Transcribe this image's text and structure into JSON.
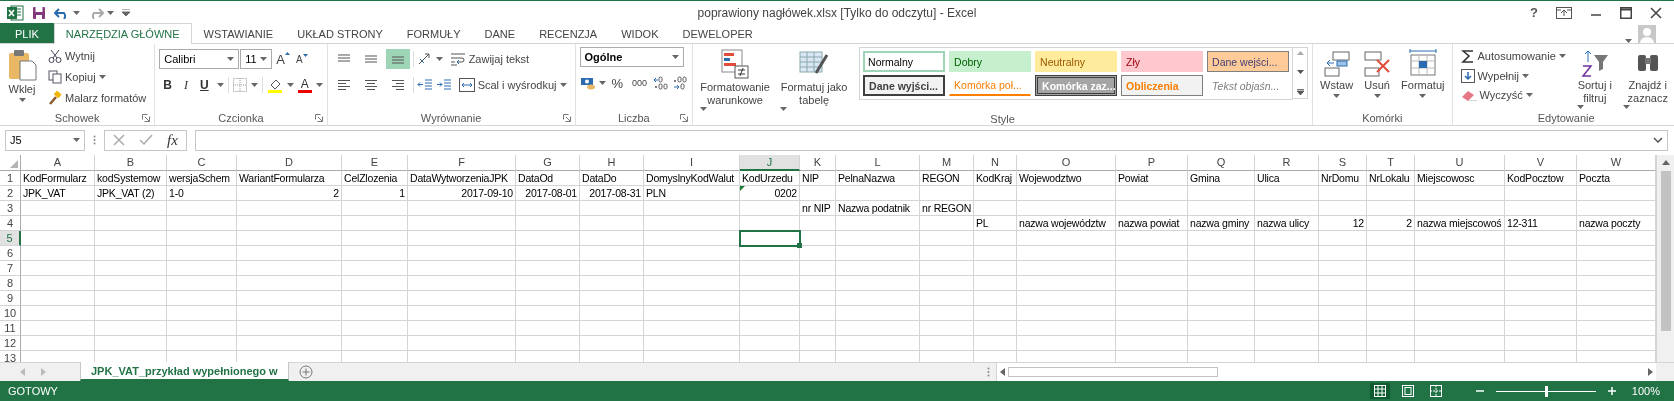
{
  "window": {
    "title": "poprawiony nagłówek.xlsx  [Tylko do odczytu] - Excel",
    "help": "?"
  },
  "tabs": [
    {
      "label": "PLIK",
      "kind": "file",
      "selected": false
    },
    {
      "label": "NARZĘDZIA GŁÓWNE",
      "kind": "tab",
      "selected": true
    },
    {
      "label": "WSTAWIANIE",
      "kind": "tab",
      "selected": false
    },
    {
      "label": "UKŁAD STRONY",
      "kind": "tab",
      "selected": false
    },
    {
      "label": "FORMUŁY",
      "kind": "tab",
      "selected": false
    },
    {
      "label": "DANE",
      "kind": "tab",
      "selected": false
    },
    {
      "label": "RECENZJA",
      "kind": "tab",
      "selected": false
    },
    {
      "label": "WIDOK",
      "kind": "tab",
      "selected": false
    },
    {
      "label": "DEWELOPER",
      "kind": "tab",
      "selected": false
    }
  ],
  "ribbon": {
    "clipboard": {
      "label": "Schowek",
      "paste": "Wklej",
      "cut": "Wytnij",
      "copy": "Kopiuj",
      "format_painter": "Malarz formatów"
    },
    "font": {
      "label": "Czcionka",
      "family": "Calibri",
      "size": "11",
      "grow": "A",
      "shrink": "A",
      "bold": "B",
      "italic": "I",
      "underline": "U",
      "font_color": "A"
    },
    "alignment": {
      "label": "Wyrównanie",
      "wrap": "Zawijaj tekst",
      "merge": "Scal i wyśrodkuj",
      "vertical": [
        {
          "selected": false
        },
        {
          "selected": false
        },
        {
          "selected": true
        }
      ],
      "horizontal": [
        {
          "selected": false
        },
        {
          "selected": false
        },
        {
          "selected": false
        }
      ]
    },
    "number": {
      "label": "Liczba",
      "format": "Ogólne",
      "percent": "%",
      "thousands": "000"
    },
    "styles": {
      "label": "Style",
      "conditional": "Formatowanie warunkowe",
      "as_table": "Formatuj jako tabelę",
      "gallery": [
        {
          "label": "Normalny",
          "kind": "normal",
          "selected": true
        },
        {
          "label": "Dobry",
          "kind": "good",
          "selected": false
        },
        {
          "label": "Neutralny",
          "kind": "neutral",
          "selected": false
        },
        {
          "label": "Zły",
          "kind": "bad",
          "selected": false
        },
        {
          "label": "Dane wejści...",
          "kind": "input",
          "selected": false
        },
        {
          "label": "Dane wyjści...",
          "kind": "output",
          "selected": false
        },
        {
          "label": "Komórka poł...",
          "kind": "linked",
          "selected": false
        },
        {
          "label": "Komórka zaz...",
          "kind": "check",
          "selected": false
        },
        {
          "label": "Obliczenia",
          "kind": "calculation",
          "selected": false
        },
        {
          "label": "Tekst objaśn...",
          "kind": "explanatory",
          "selected": false
        }
      ]
    },
    "cells": {
      "label": "Komórki",
      "insert": "Wstaw",
      "delete": "Usuń",
      "format": "Formatuj"
    },
    "editing": {
      "label": "Edytowanie",
      "autosum": "Autosumowanie",
      "fill": "Wypełnij",
      "clear": "Wyczyść",
      "sort": "Sortuj i filtruj",
      "find": "Znajdź i zaznacz"
    }
  },
  "formula_bar": {
    "name_box": "J5",
    "fx": "fx"
  },
  "sheet": {
    "columns": [
      {
        "label": "A",
        "selected": false
      },
      {
        "label": "B",
        "selected": false
      },
      {
        "label": "C",
        "selected": false
      },
      {
        "label": "D",
        "selected": false
      },
      {
        "label": "E",
        "selected": false
      },
      {
        "label": "F",
        "selected": false
      },
      {
        "label": "G",
        "selected": false
      },
      {
        "label": "H",
        "selected": false
      },
      {
        "label": "I",
        "selected": false
      },
      {
        "label": "J",
        "selected": true
      },
      {
        "label": "K",
        "selected": false
      },
      {
        "label": "L",
        "selected": false
      },
      {
        "label": "M",
        "selected": false
      },
      {
        "label": "N",
        "selected": false
      },
      {
        "label": "O",
        "selected": false
      },
      {
        "label": "P",
        "selected": false
      },
      {
        "label": "Q",
        "selected": false
      },
      {
        "label": "R",
        "selected": false
      },
      {
        "label": "S",
        "selected": false
      },
      {
        "label": "T",
        "selected": false
      },
      {
        "label": "U",
        "selected": false
      },
      {
        "label": "V",
        "selected": false
      },
      {
        "label": "W",
        "selected": false
      }
    ],
    "rows": [
      {
        "label": "1",
        "selected": false,
        "cells": [
          {
            "text": "KodFormularz",
            "kind": "text"
          },
          {
            "text": "kodSystemow",
            "kind": "text"
          },
          {
            "text": "wersjaSchem",
            "kind": "text"
          },
          {
            "text": "WariantFormularza",
            "kind": "text"
          },
          {
            "text": "CelZlozenia",
            "kind": "text"
          },
          {
            "text": "DataWytworzeniaJPK",
            "kind": "text"
          },
          {
            "text": "DataOd",
            "kind": "text"
          },
          {
            "text": "DataDo",
            "kind": "text"
          },
          {
            "text": "DomyslnyKodWalut",
            "kind": "text"
          },
          {
            "text": "KodUrzedu",
            "kind": "text"
          },
          {
            "text": "NIP",
            "kind": "text"
          },
          {
            "text": "PelnaNazwa",
            "kind": "text"
          },
          {
            "text": "REGON",
            "kind": "text"
          },
          {
            "text": "KodKraj",
            "kind": "text"
          },
          {
            "text": "Wojewodztwo",
            "kind": "text"
          },
          {
            "text": "Powiat",
            "kind": "text"
          },
          {
            "text": "Gmina",
            "kind": "text"
          },
          {
            "text": "Ulica",
            "kind": "text"
          },
          {
            "text": "NrDomu",
            "kind": "text"
          },
          {
            "text": "NrLokalu",
            "kind": "text"
          },
          {
            "text": "Miejscowosc",
            "kind": "text"
          },
          {
            "text": "KodPocztow",
            "kind": "text"
          },
          {
            "text": "Poczta",
            "kind": "text"
          }
        ]
      },
      {
        "label": "2",
        "selected": false,
        "cells": [
          {
            "text": "JPK_VAT",
            "kind": "text"
          },
          {
            "text": "JPK_VAT (2)",
            "kind": "text"
          },
          {
            "text": "1-0",
            "kind": "text"
          },
          {
            "text": "2",
            "kind": "number"
          },
          {
            "text": "1",
            "kind": "number"
          },
          {
            "text": "2017-09-10",
            "kind": "number"
          },
          {
            "text": "2017-08-01",
            "kind": "number"
          },
          {
            "text": "2017-08-31",
            "kind": "number"
          },
          {
            "text": "PLN",
            "kind": "text"
          },
          {
            "text": "0202",
            "kind": "number",
            "flag": true
          }
        ]
      },
      {
        "label": "3",
        "selected": false,
        "cells": [
          null,
          null,
          null,
          null,
          null,
          null,
          null,
          null,
          null,
          null,
          {
            "text": "nr NIP",
            "kind": "text"
          },
          {
            "text": "Nazwa podatnik",
            "kind": "text"
          },
          {
            "text": "nr REGON",
            "kind": "text"
          }
        ]
      },
      {
        "label": "4",
        "selected": false,
        "cells": [
          null,
          null,
          null,
          null,
          null,
          null,
          null,
          null,
          null,
          null,
          null,
          null,
          null,
          {
            "text": "PL",
            "kind": "text"
          },
          {
            "text": "nazwa województw",
            "kind": "text"
          },
          {
            "text": "nazwa powiat",
            "kind": "text"
          },
          {
            "text": "nazwa gminy",
            "kind": "text"
          },
          {
            "text": "nazwa ulicy",
            "kind": "text"
          },
          {
            "text": "12",
            "kind": "number"
          },
          {
            "text": "2",
            "kind": "number"
          },
          {
            "text": "nazwa miejscowoś",
            "kind": "text"
          },
          {
            "text": "12-311",
            "kind": "text"
          },
          {
            "text": "nazwa poczty",
            "kind": "text"
          }
        ]
      },
      {
        "label": "5",
        "selected": true
      },
      {
        "label": "6",
        "selected": false
      },
      {
        "label": "7",
        "selected": false
      },
      {
        "label": "8",
        "selected": false
      },
      {
        "label": "9",
        "selected": false
      },
      {
        "label": "10",
        "selected": false
      },
      {
        "label": "11",
        "selected": false
      },
      {
        "label": "12",
        "selected": false
      },
      {
        "label": "13",
        "selected": false
      }
    ]
  },
  "sheet_tabs": [
    {
      "label": "JPK_VAT_przykład wypełnionego w",
      "selected": true
    }
  ],
  "status_bar": {
    "status": "GOTOWY",
    "zoom": "100%",
    "zoom_slider": {
      "level": 0.5
    },
    "views": [
      {
        "selected": true
      },
      {
        "selected": false
      },
      {
        "selected": false
      }
    ]
  }
}
